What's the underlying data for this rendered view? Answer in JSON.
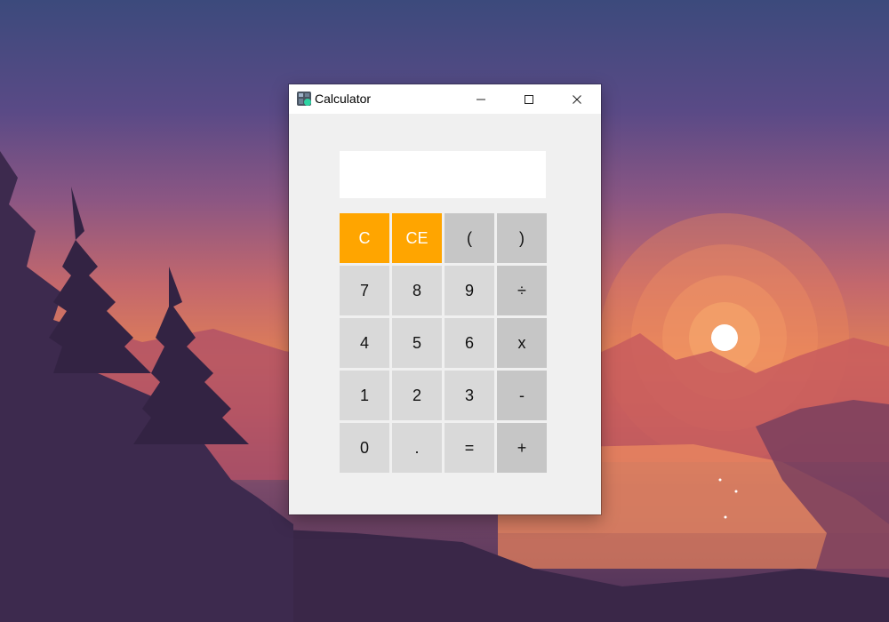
{
  "window": {
    "title": "Calculator",
    "controls": {
      "minimize_icon": "minimize-icon",
      "maximize_icon": "maximize-icon",
      "close_icon": "close-icon"
    }
  },
  "display": {
    "value": ""
  },
  "keys": {
    "row1": [
      "C",
      "CE",
      "(",
      ")"
    ],
    "row2": [
      "7",
      "8",
      "9",
      "÷"
    ],
    "row3": [
      "4",
      "5",
      "6",
      "x"
    ],
    "row4": [
      "1",
      "2",
      "3",
      "-"
    ],
    "row5": [
      "0",
      ".",
      "=",
      "+"
    ]
  },
  "colors": {
    "clear_keys": "#ffa500",
    "number_keys": "#d9d9d9",
    "operator_keys": "#c6c6c6",
    "window_background": "#f0f0f0"
  }
}
